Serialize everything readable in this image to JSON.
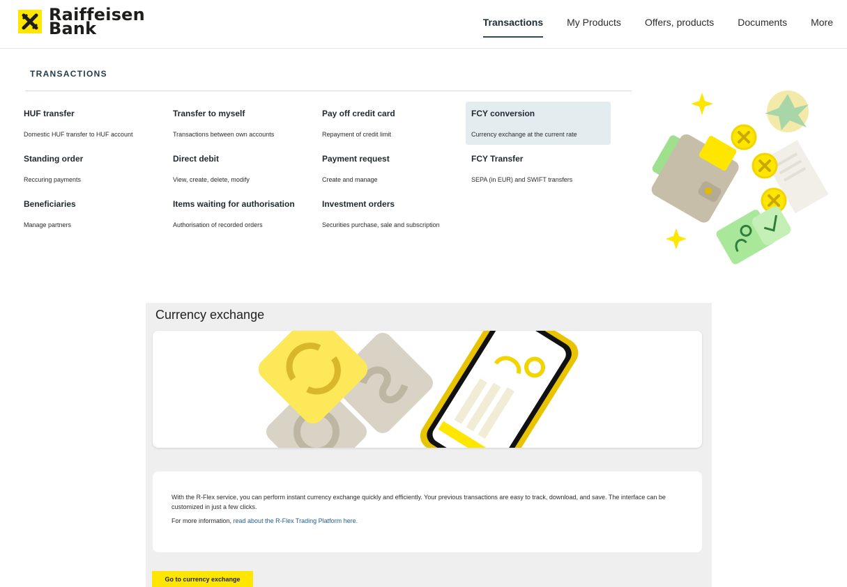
{
  "brand": {
    "name_line1": "Raiffeisen",
    "name_line2": "Bank"
  },
  "nav": [
    {
      "label": "Transactions",
      "active": true
    },
    {
      "label": "My Products"
    },
    {
      "label": "Offers, products"
    },
    {
      "label": "Documents"
    },
    {
      "label": "More"
    }
  ],
  "menu": {
    "title": "TRANSACTIONS",
    "items": [
      {
        "title": "HUF transfer",
        "desc": "Domestic HUF transfer to HUF account"
      },
      {
        "title": "Transfer to myself",
        "desc": "Transactions between own accounts"
      },
      {
        "title": "Pay off credit card",
        "desc": "Repayment of credit limit"
      },
      {
        "title": "FCY conversion",
        "desc": "Currency exchange at the current rate",
        "highlighted": true
      },
      {
        "title": "Standing order",
        "desc": "Reccuring payments"
      },
      {
        "title": "Direct debit",
        "desc": "View, create, delete, modify"
      },
      {
        "title": "Payment request",
        "desc": "Create and manage"
      },
      {
        "title": "FCY Transfer",
        "desc": "SEPA (in EUR) and SWIFT transfers"
      },
      {
        "title": "Beneficiaries",
        "desc": "Manage partners"
      },
      {
        "title": "Items waiting for authorisation",
        "desc": "Authorisation of recorded orders"
      },
      {
        "title": "Investment orders",
        "desc": "Securities purchase, sale and subscription"
      }
    ]
  },
  "panel": {
    "title": "Currency exchange",
    "body": "With the R-Flex service, you can perform instant currency exchange quickly and efficiently. Your previous transactions are easy to track, download, and save. The interface can be customized in just a few clicks.",
    "more_prefix": "For more information, ",
    "more_link": "read about the R-Flex Trading Platform here.",
    "cta": "Go to currency exchange"
  },
  "colors": {
    "brand_yellow": "#fee600",
    "nav_underline": "#2b4a5a",
    "highlight_bg": "#e3edf0",
    "panel_bg": "#f0efef",
    "link": "#1f5f8b"
  }
}
